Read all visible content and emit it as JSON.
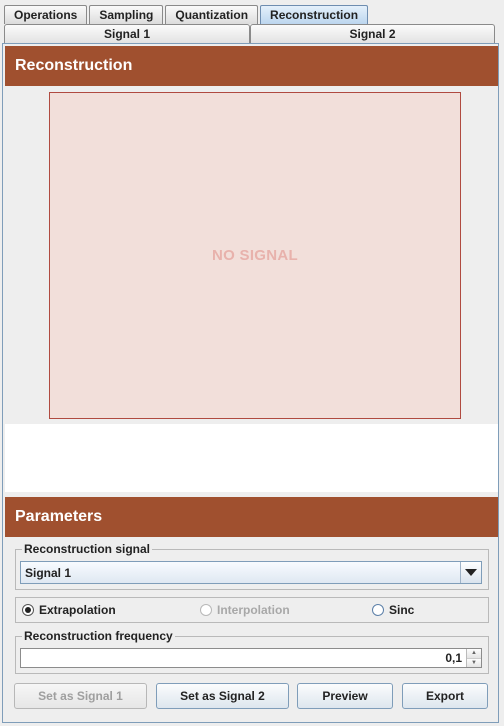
{
  "top_tabs": [
    {
      "label": "Operations"
    },
    {
      "label": "Sampling"
    },
    {
      "label": "Quantization"
    },
    {
      "label": "Reconstruction",
      "active": true
    }
  ],
  "signal_tabs": [
    {
      "label": "Signal 1"
    },
    {
      "label": "Signal 2"
    }
  ],
  "reconstruction": {
    "header": "Reconstruction",
    "placeholder": "NO SIGNAL"
  },
  "parameters": {
    "header": "Parameters",
    "signal_group": {
      "title": "Reconstruction signal",
      "selected": "Signal 1"
    },
    "methods": [
      {
        "label": "Extrapolation",
        "checked": true,
        "enabled": true
      },
      {
        "label": "Interpolation",
        "checked": false,
        "enabled": false
      },
      {
        "label": "Sinc",
        "checked": false,
        "enabled": true
      }
    ],
    "frequency_group": {
      "title": "Reconstruction frequency",
      "value": "0,1"
    }
  },
  "buttons": {
    "set_signal_1": "Set as Signal 1",
    "set_signal_2": "Set as Signal 2",
    "preview": "Preview",
    "export": "Export"
  },
  "colors": {
    "header_bg": "#a0502f",
    "chart_bg": "#f2dfda",
    "chart_border": "#b04a40",
    "placeholder_text": "#e8b2ac"
  }
}
